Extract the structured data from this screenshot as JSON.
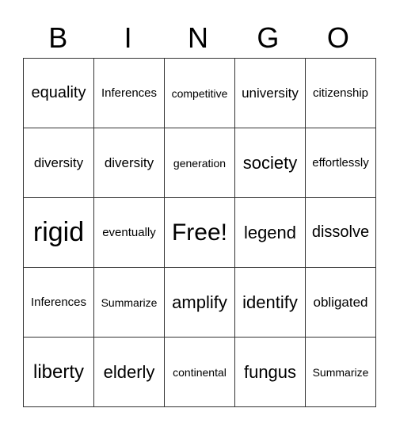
{
  "header": [
    "B",
    "I",
    "N",
    "G",
    "O"
  ],
  "rows": [
    [
      "equality",
      "Inferences",
      "competitive",
      "university",
      "citizenship"
    ],
    [
      "diversity",
      "diversity",
      "generation",
      "society",
      "effortlessly"
    ],
    [
      "rigid",
      "eventually",
      "Free!",
      "legend",
      "dissolve"
    ],
    [
      "Inferences",
      "Summarize",
      "amplify",
      "identify",
      "obligated"
    ],
    [
      "liberty",
      "elderly",
      "continental",
      "fungus",
      "Summarize"
    ]
  ]
}
